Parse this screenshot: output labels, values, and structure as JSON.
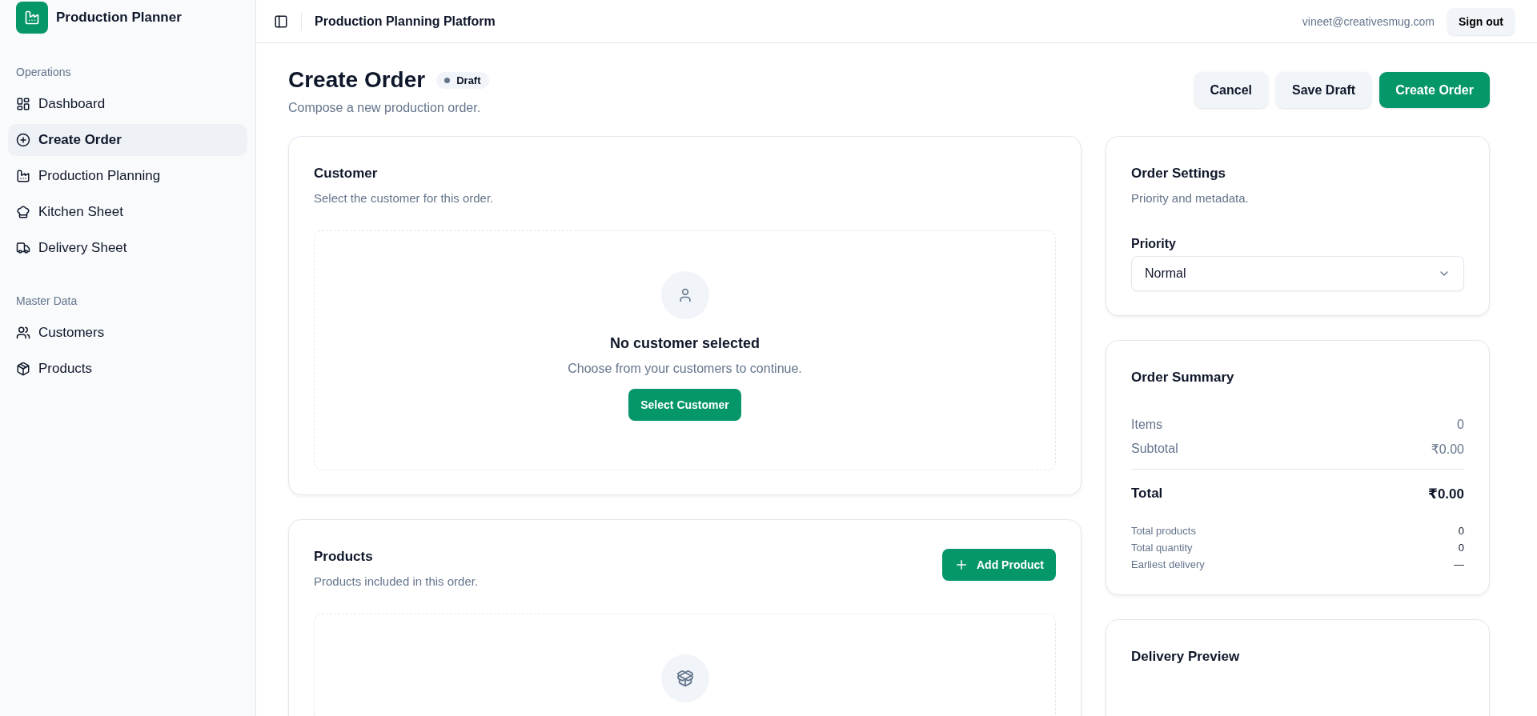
{
  "app": {
    "name": "Production Planner"
  },
  "sidebar": {
    "sections": [
      {
        "title": "Operations",
        "items": [
          {
            "label": "Dashboard",
            "selected": false
          },
          {
            "label": "Create Order",
            "selected": true
          },
          {
            "label": "Production Planning",
            "selected": false
          },
          {
            "label": "Kitchen Sheet",
            "selected": false
          },
          {
            "label": "Delivery Sheet",
            "selected": false
          }
        ]
      },
      {
        "title": "Master Data",
        "items": [
          {
            "label": "Customers",
            "selected": false
          },
          {
            "label": "Products",
            "selected": false
          }
        ]
      }
    ]
  },
  "topbar": {
    "title": "Production Planning Platform",
    "user": "vineet@creativesmug.com",
    "sign_out": "Sign out"
  },
  "page": {
    "title": "Create Order",
    "status": "Draft",
    "subtitle": "Compose a new production order.",
    "actions": [
      {
        "label": "Cancel",
        "kind": "secondary"
      },
      {
        "label": "Save Draft",
        "kind": "secondary"
      },
      {
        "label": "Create Order",
        "kind": "primary"
      }
    ]
  },
  "customer": {
    "title": "Customer",
    "description": "Select the customer for this order.",
    "empty_title": "No customer selected",
    "empty_text": "Choose from your customers to continue.",
    "button": "Select Customer"
  },
  "products": {
    "title": "Products",
    "description": "Products included in this order.",
    "button": "Add Product"
  },
  "order_settings": {
    "title": "Order Settings",
    "description": "Priority and metadata.",
    "priority_label": "Priority",
    "priority_value": "Normal"
  },
  "order_summary": {
    "title": "Order Summary",
    "lines": [
      {
        "label": "Items",
        "value": "0"
      },
      {
        "label": "Subtotal",
        "value": "₹0.00"
      }
    ],
    "total_label": "Total",
    "total_value": "₹0.00",
    "stats": [
      {
        "label": "Total products",
        "value": "0"
      },
      {
        "label": "Total quantity",
        "value": "0"
      },
      {
        "label": "Earliest delivery",
        "value": "—"
      }
    ]
  },
  "delivery_preview": {
    "title": "Delivery Preview"
  }
}
